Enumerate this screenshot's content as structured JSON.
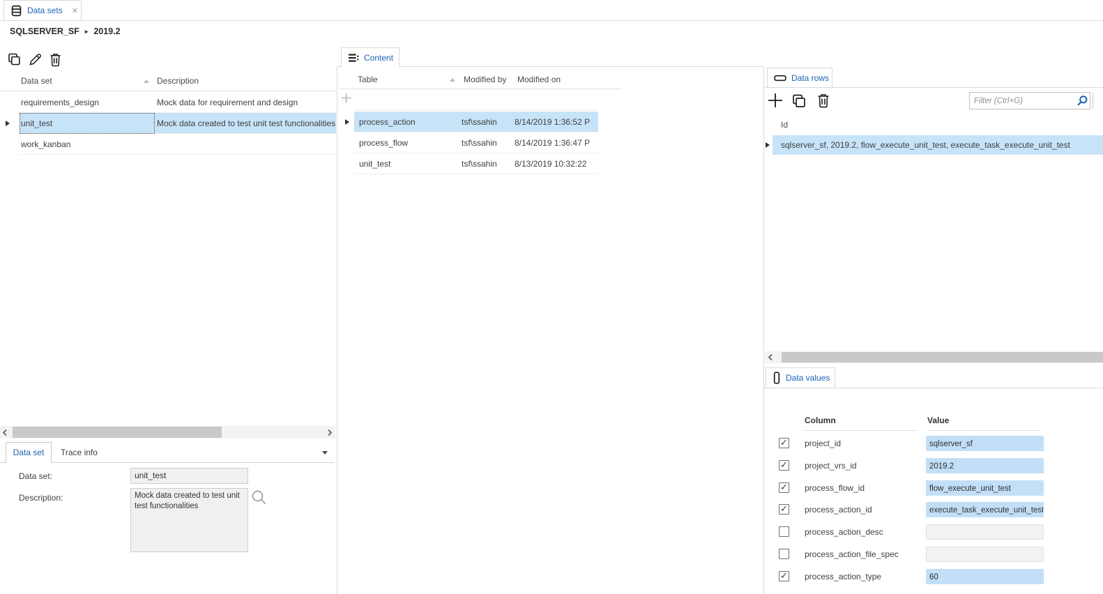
{
  "colors": {
    "accent_text": "#1b62b5",
    "selection_fill": "#c7e3f8",
    "value_fill": "#c2dff7"
  },
  "window_tab": {
    "icon": "database-icon",
    "label": "Data sets",
    "close_glyph": "✕"
  },
  "breadcrumb": {
    "project": "SQLSERVER_SF",
    "separator": "▸",
    "version": "2019.2"
  },
  "left_panel": {
    "toolbar": {
      "copy": "copy",
      "edit": "edit",
      "delete": "delete"
    },
    "grid": {
      "col_data_set": "Data set",
      "col_description": "Description",
      "rows": [
        {
          "data_set": "requirements_design",
          "description": "Mock data for requirement and design",
          "selected": false
        },
        {
          "data_set": "unit_test",
          "description": "Mock data created to test unit test functionalities",
          "selected": true
        },
        {
          "data_set": "work_kanban",
          "description": "",
          "selected": false
        }
      ]
    },
    "subtabs": {
      "data_set": "Data set",
      "trace_info": "Trace info"
    },
    "form": {
      "data_set_label": "Data set:",
      "data_set_value": "unit_test",
      "description_label": "Description:",
      "description_value": "Mock data created to test unit test functionalities"
    }
  },
  "content_panel": {
    "tab_label": "Content",
    "grid": {
      "col_table": "Table",
      "col_modified_by": "Modified by",
      "col_modified_on": "Modified on",
      "rows": [
        {
          "table": "process_action",
          "modified_by": "tsf\\ssahin",
          "modified_on": "8/14/2019 1:36:52 P",
          "selected": true
        },
        {
          "table": "process_flow",
          "modified_by": "tsf\\ssahin",
          "modified_on": "8/14/2019 1:36:47 P",
          "selected": false
        },
        {
          "table": "unit_test",
          "modified_by": "tsf\\ssahin",
          "modified_on": "8/13/2019 10:32:22",
          "selected": false
        }
      ]
    }
  },
  "data_rows_panel": {
    "tab_label": "Data rows",
    "filter_placeholder": "Filter (Ctrl+G)",
    "grid": {
      "col_id": "Id",
      "rows": [
        {
          "id": "sqlserver_sf, 2019.2, flow_execute_unit_test, execute_task_execute_unit_test",
          "selected": true
        }
      ]
    }
  },
  "data_values_panel": {
    "tab_label": "Data values",
    "grid": {
      "col_column": "Column",
      "col_value": "Value",
      "rows": [
        {
          "checked": true,
          "column": "project_id",
          "value": "sqlserver_sf"
        },
        {
          "checked": true,
          "column": "project_vrs_id",
          "value": "2019.2"
        },
        {
          "checked": true,
          "column": "process_flow_id",
          "value": "flow_execute_unit_test"
        },
        {
          "checked": true,
          "column": "process_action_id",
          "value": "execute_task_execute_unit_test"
        },
        {
          "checked": false,
          "column": "process_action_desc",
          "value": ""
        },
        {
          "checked": false,
          "column": "process_action_file_spec",
          "value": ""
        },
        {
          "checked": true,
          "column": "process_action_type",
          "value": "60"
        }
      ]
    }
  }
}
